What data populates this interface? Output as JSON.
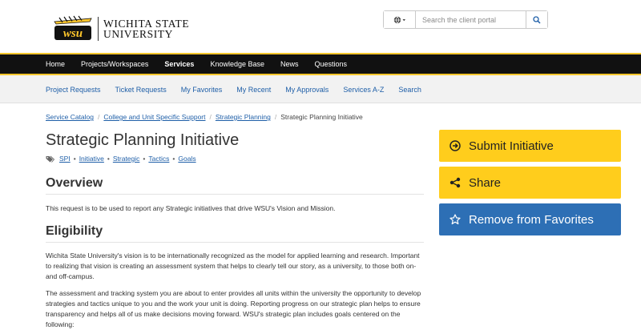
{
  "header": {
    "logo_line1": "WICHITA STATE",
    "logo_line2": "UNIVERSITY",
    "logo_mark_text": "wsu",
    "search_placeholder": "Search the client portal",
    "icons": {
      "language": "globe-icon",
      "search": "search-icon"
    }
  },
  "main_nav": {
    "items": [
      {
        "label": "Home"
      },
      {
        "label": "Projects/Workspaces"
      },
      {
        "label": "Services"
      },
      {
        "label": "Knowledge Base"
      },
      {
        "label": "News"
      },
      {
        "label": "Questions"
      }
    ],
    "active": "Services"
  },
  "sub_nav": {
    "items": [
      {
        "label": "Project Requests"
      },
      {
        "label": "Ticket Requests"
      },
      {
        "label": "My Favorites"
      },
      {
        "label": "My Recent"
      },
      {
        "label": "My Approvals"
      },
      {
        "label": "Services A-Z"
      },
      {
        "label": "Search"
      }
    ]
  },
  "breadcrumb": {
    "items": [
      "Service Catalog",
      "College and Unit Specific Support",
      "Strategic Planning"
    ],
    "current": "Strategic Planning Initiative",
    "separator": "/"
  },
  "page": {
    "title": "Strategic Planning Initiative",
    "tags": [
      "SPI",
      "Initiative",
      "Strategic",
      "Tactics",
      "Goals"
    ],
    "tag_separator": "•"
  },
  "overview": {
    "heading": "Overview",
    "text": "This request is to be used to report any Strategic initiatives that drive WSU's Vision and Mission."
  },
  "eligibility": {
    "heading": "Eligibility",
    "para1": "Wichita State University's vision is to be internationally recognized as the model for applied learning and research. Important to realizing that vision is creating an assessment system that helps to clearly tell our story, as a university, to those both on-and off-campus.",
    "para2": "The assessment and tracking system you are about to enter provides all units within the university the opportunity to develop strategies and tactics unique to you and the work your unit is doing. Reporting progress on our strategic plan helps to ensure transparency and helps all of us make decisions moving forward. WSU's strategic plan includes goals centered on the following:"
  },
  "actions": {
    "submit": "Submit Initiative",
    "share": "Share",
    "favorite": "Remove from Favorites"
  },
  "colors": {
    "brand_yellow": "#ffc72c",
    "nav_black": "#111111",
    "link_blue": "#1f5fa8",
    "action_yellow": "#ffcd1c",
    "action_blue": "#2d6fb5"
  }
}
